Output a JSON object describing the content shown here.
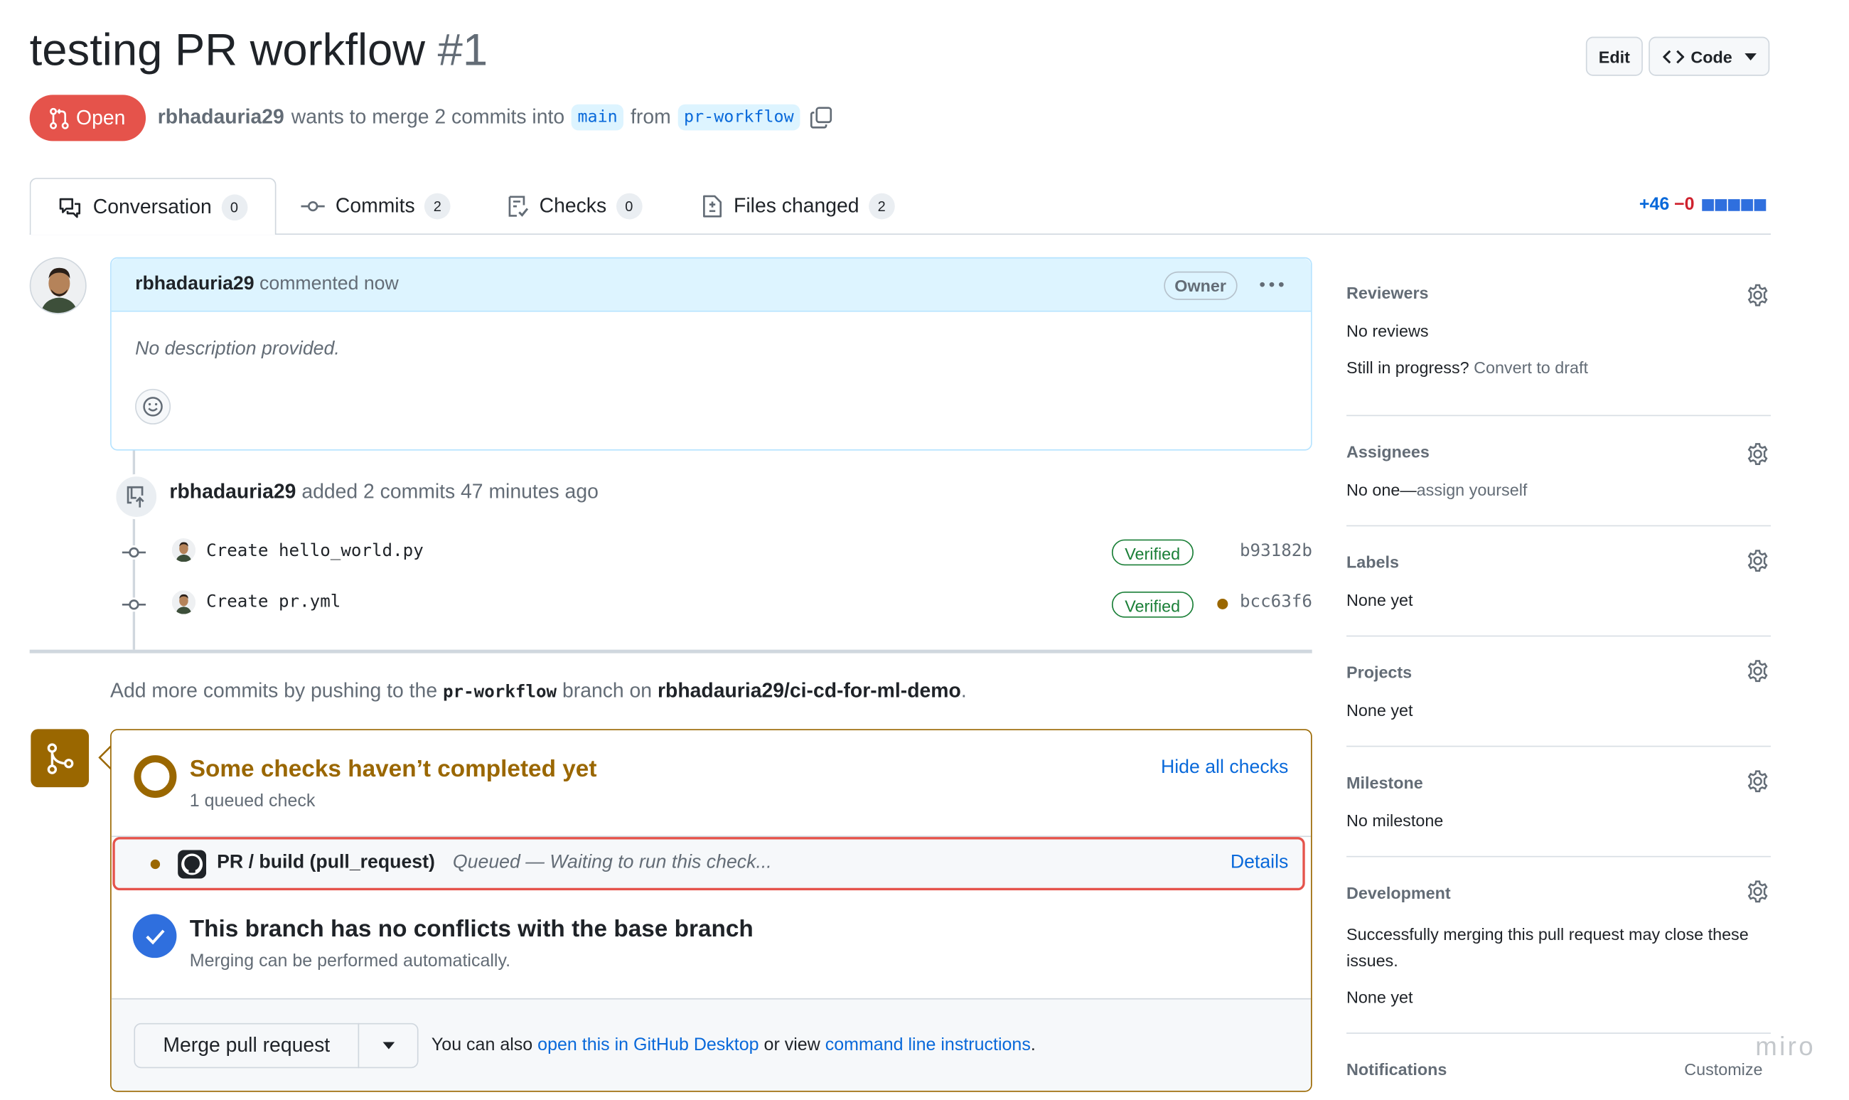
{
  "pr": {
    "title": "testing PR workflow",
    "number": "#1",
    "state": "Open",
    "author": "rbhadauria29",
    "merge_text": "wants to merge 2 commits into",
    "base_branch": "main",
    "from_text": "from",
    "head_branch": "pr-workflow"
  },
  "header_buttons": {
    "edit": "Edit",
    "code": "Code"
  },
  "tabs": [
    {
      "label": "Conversation",
      "count": "0"
    },
    {
      "label": "Commits",
      "count": "2"
    },
    {
      "label": "Checks",
      "count": "0"
    },
    {
      "label": "Files changed",
      "count": "2"
    }
  ],
  "diffstat": {
    "additions": "+46",
    "deletions": "−0"
  },
  "comment": {
    "author": "rbhadauria29",
    "action": "commented now",
    "role": "Owner",
    "body": "No description provided."
  },
  "commits_event": {
    "author": "rbhadauria29",
    "text": "added 2 commits 47 minutes ago",
    "commits": [
      {
        "message": "Create hello_world.py",
        "verified": "Verified",
        "sha": "b93182b"
      },
      {
        "message": "Create pr.yml",
        "verified": "Verified",
        "sha": "bcc63f6"
      }
    ]
  },
  "push_hint": {
    "prefix": "Add more commits by pushing to the",
    "branch": "pr-workflow",
    "middle": "branch on",
    "repo": "rbhadauria29/ci-cd-for-ml-demo",
    "suffix": "."
  },
  "checks": {
    "title": "Some checks haven’t completed yet",
    "subtitle": "1 queued check",
    "hide_link": "Hide all checks",
    "check_name": "PR / build (pull_request)",
    "check_status": "Queued — Waiting to run this check...",
    "details_link": "Details"
  },
  "conflicts": {
    "title": "This branch has no conflicts with the base branch",
    "subtitle": "Merging can be performed automatically."
  },
  "merge": {
    "button": "Merge pull request",
    "also_text": "You can also",
    "desktop_link": "open this in GitHub Desktop",
    "or_text": "or view",
    "cli_link": "command line instructions",
    "end": "."
  },
  "sidebar": {
    "reviewers": {
      "title": "Reviewers",
      "value": "No reviews",
      "hint": "Still in progress?",
      "hint_link": "Convert to draft"
    },
    "assignees": {
      "title": "Assignees",
      "value": "No one—",
      "link": "assign yourself"
    },
    "labels": {
      "title": "Labels",
      "value": "None yet"
    },
    "projects": {
      "title": "Projects",
      "value": "None yet"
    },
    "milestone": {
      "title": "Milestone",
      "value": "No milestone"
    },
    "development": {
      "title": "Development",
      "value": "Successfully merging this pull request may close these issues.",
      "value2": "None yet"
    },
    "notifications": {
      "title": "Notifications",
      "action": "Customize"
    }
  },
  "watermark": "miro",
  "colors": {
    "open_badge": "#e5534b",
    "accent_link": "#0969da",
    "pending": "#9a6700",
    "success_blue": "#2f6fde",
    "highlight_border": "#e5534b"
  },
  "icons": [
    "git-pull-request-icon",
    "copy-icon",
    "code-icon",
    "caret-down-icon",
    "comment-discussion-icon",
    "git-commit-icon",
    "checklist-icon",
    "file-diff-icon",
    "kebab-horizontal-icon",
    "smiley-icon",
    "repo-push-icon",
    "git-merge-icon",
    "github-mark-icon",
    "check-circle-icon",
    "gear-icon"
  ]
}
